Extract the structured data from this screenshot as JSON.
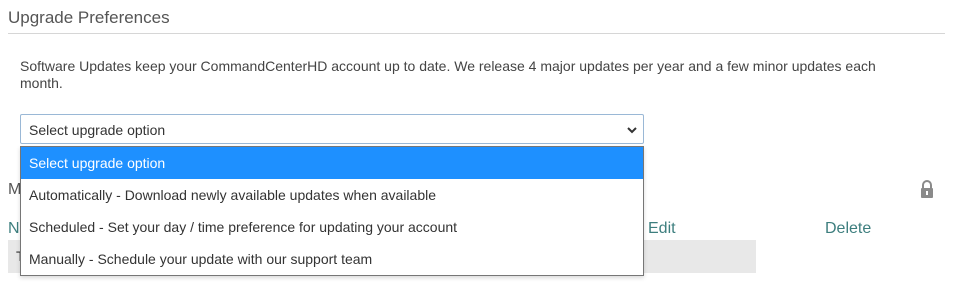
{
  "section": {
    "title": "Upgrade Preferences"
  },
  "description": "Software Updates keep your CommandCenterHD account up to date. We release 4 major updates per year and a few minor updates each month.",
  "upgrade_select": {
    "value": "Select upgrade option",
    "options": [
      "Select upgrade option",
      "Automatically - Download newly available updates when available",
      "Scheduled - Set your day / time preference for updating your account",
      "Manually - Schedule your update with our support team"
    ],
    "selected_index": 0
  },
  "background": {
    "heading_partial": "M",
    "column_partial": "N",
    "row_partial": "T",
    "edit_label": "Edit",
    "delete_label": "Delete"
  },
  "colors": {
    "selected": "#1e90ff",
    "link": "#3d7e7e"
  },
  "icons": {
    "lock": "lock-icon",
    "chevron": "chevron-down-icon"
  }
}
